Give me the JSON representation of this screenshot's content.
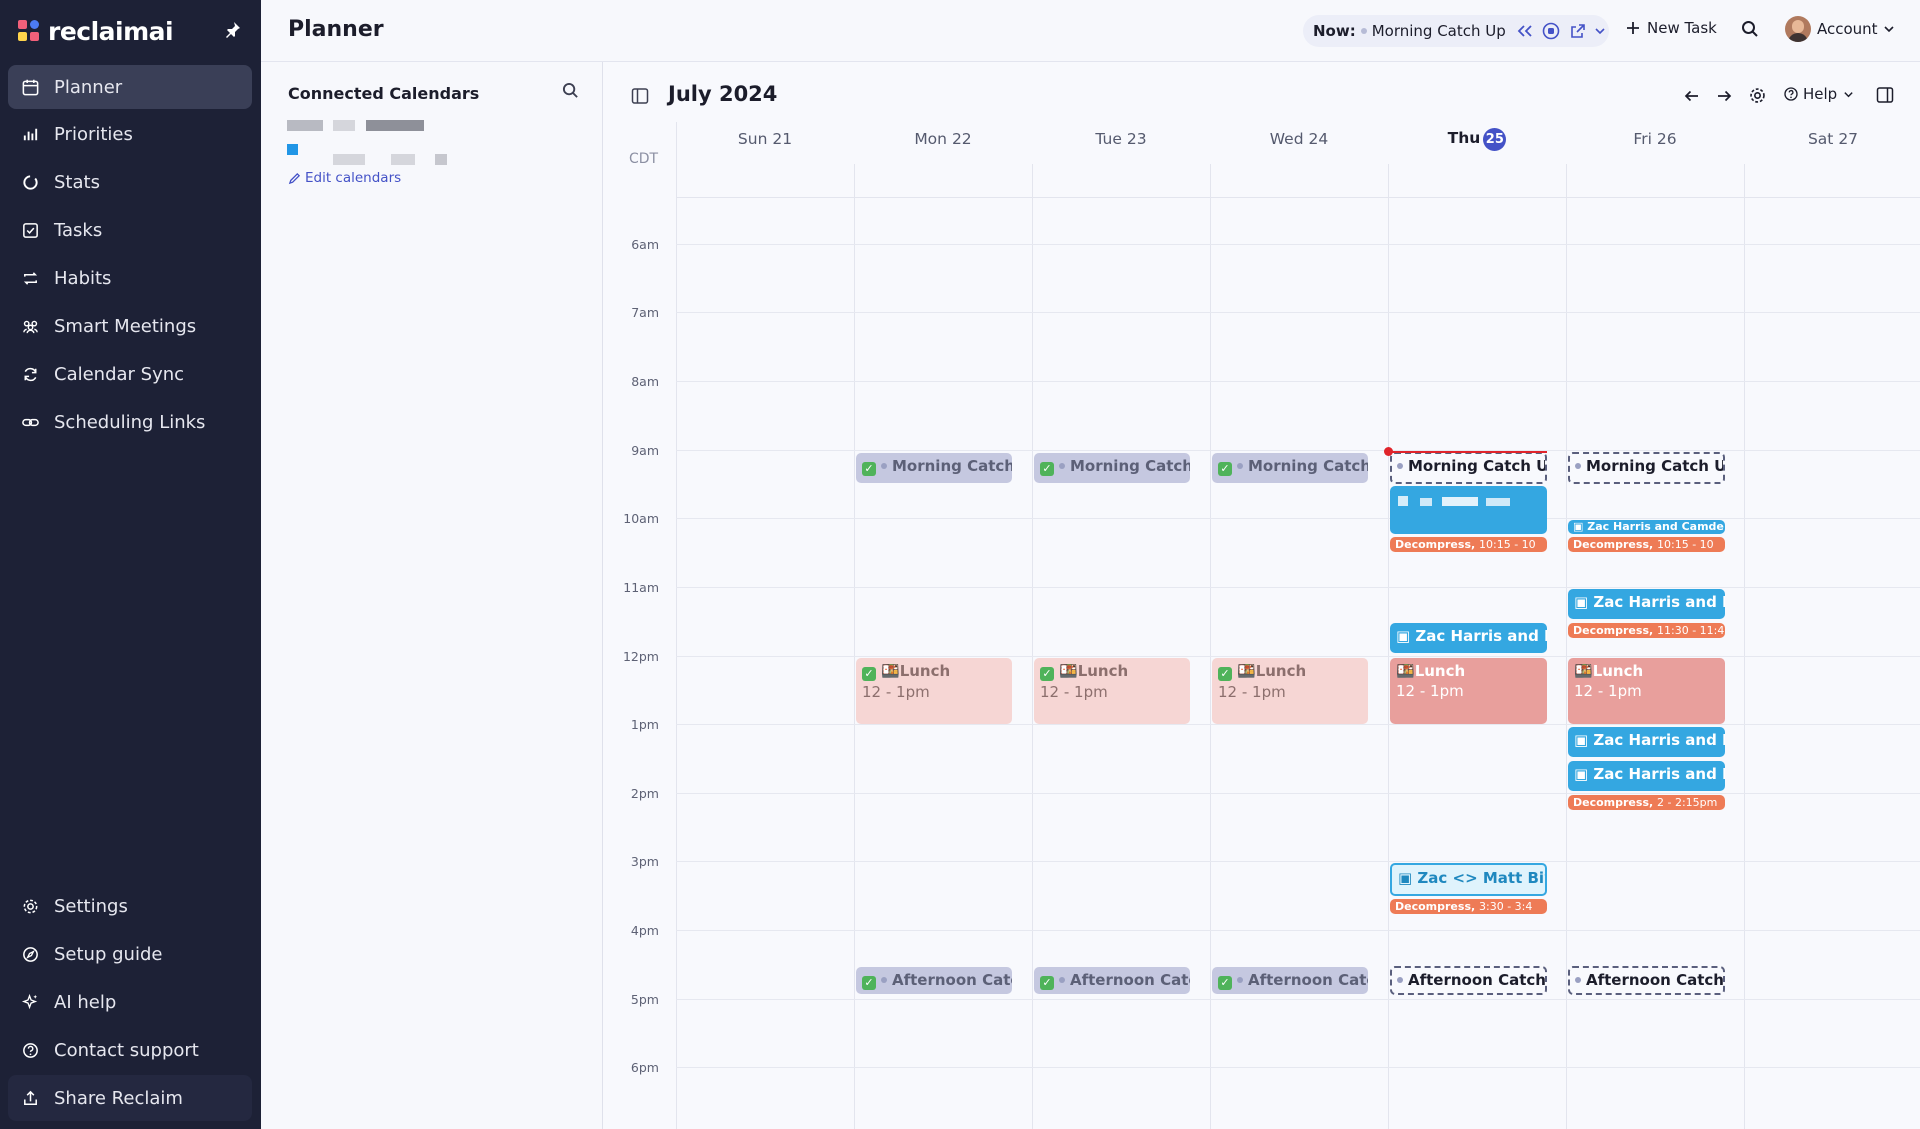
{
  "brand": {
    "name": "reclaimai"
  },
  "sidebar": {
    "items": [
      {
        "label": "Planner",
        "icon": "calendar-icon"
      },
      {
        "label": "Priorities",
        "icon": "bar-chart-icon"
      },
      {
        "label": "Stats",
        "icon": "donut-icon"
      },
      {
        "label": "Tasks",
        "icon": "checkbox-icon"
      },
      {
        "label": "Habits",
        "icon": "repeat-icon"
      },
      {
        "label": "Smart Meetings",
        "icon": "people-icon"
      },
      {
        "label": "Calendar Sync",
        "icon": "sync-icon"
      },
      {
        "label": "Scheduling Links",
        "icon": "link-icon"
      }
    ],
    "bottom_items": [
      {
        "label": "Settings",
        "icon": "gear-icon"
      },
      {
        "label": "Setup guide",
        "icon": "compass-icon"
      },
      {
        "label": "AI help",
        "icon": "sparkle-icon"
      },
      {
        "label": "Contact support",
        "icon": "help-icon"
      },
      {
        "label": "Share Reclaim",
        "icon": "share-icon"
      }
    ]
  },
  "topbar": {
    "title": "Planner",
    "now_label": "Now:",
    "now_event": "Morning Catch Up",
    "new_task": "New Task",
    "account": "Account"
  },
  "calendars_panel": {
    "title": "Connected Calendars",
    "edit_link": "Edit calendars"
  },
  "calendar": {
    "month": "July 2024",
    "timezone": "CDT",
    "help": "Help",
    "days": [
      {
        "name": "Sun",
        "num": "21"
      },
      {
        "name": "Mon",
        "num": "22"
      },
      {
        "name": "Tue",
        "num": "23"
      },
      {
        "name": "Wed",
        "num": "24"
      },
      {
        "name": "Thu",
        "num": "25",
        "today": true
      },
      {
        "name": "Fri",
        "num": "26"
      },
      {
        "name": "Sat",
        "num": "27"
      }
    ],
    "hours": [
      "6am",
      "7am",
      "8am",
      "9am",
      "10am",
      "11am",
      "12pm",
      "1pm",
      "2pm",
      "3pm",
      "4pm",
      "5pm",
      "6pm"
    ],
    "events": {
      "morning_done": "Morning Catch U",
      "morning_today": "Morning Catch Up,",
      "lunch": "Lunch",
      "lunch_time": "12 - 1pm",
      "afternoon_done": "Afternoon Catch",
      "afternoon_today": "Afternoon Catch Up",
      "decompress": "Decompress,",
      "decompress_1015": "10:15 - 10",
      "decompress_1130": "11:30 - 11:4",
      "decompress_2": "2 - 2:15pm",
      "decompress_330": "3:30 - 3:4",
      "zac_mic": "Zac Harris and Mic",
      "zac_camde": "Zac Harris and Camde",
      "zac_kar": "Zac Harris and Kar",
      "zac_nat": "Zac Harris and Nat",
      "zac_kyle": "Zac Harris and Kyle",
      "zac_matt": "Zac <> Matt Biweek"
    }
  },
  "colors": {
    "sidebar_bg": "#1d2136",
    "accent": "#4452c7",
    "meeting_blue": "#34a7e1",
    "decompress_orange": "#ee7b56",
    "lunch_pink": "#f6d6d4",
    "lunch_today": "#e89f9c",
    "now_red": "#e0242b"
  }
}
